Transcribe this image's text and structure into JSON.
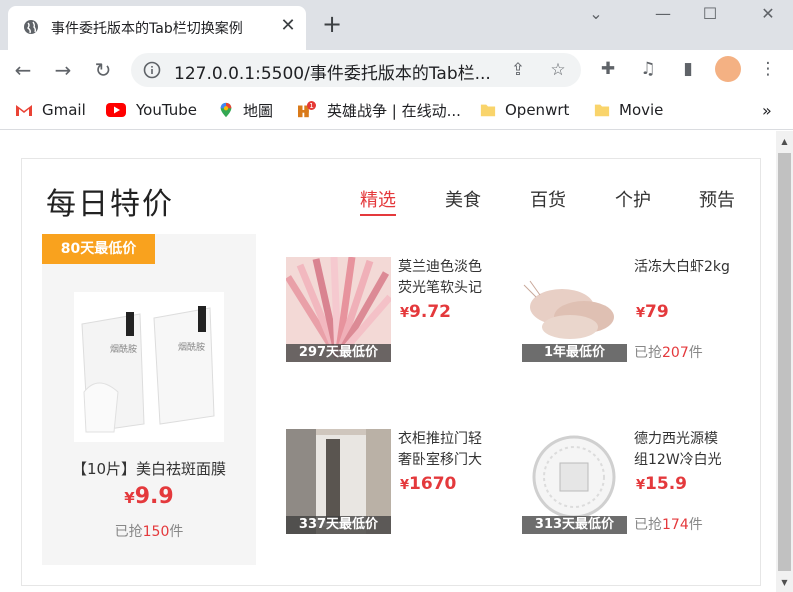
{
  "browser": {
    "tab_title": "事件委托版本的Tab栏切换案例",
    "tab_close": "✕",
    "new_tab": "+",
    "url": "127.0.0.1:5500/事件委托版本的Tab栏...",
    "window_controls": [
      "⌄",
      "—",
      "☐",
      "✕"
    ]
  },
  "bookmarks": [
    {
      "label": "Gmail",
      "icon": "gmail-icon"
    },
    {
      "label": "YouTube",
      "icon": "youtube-icon"
    },
    {
      "label": "地圖",
      "icon": "maps-icon"
    },
    {
      "label": "英雄战争 | 在线动...",
      "icon": "game-icon"
    },
    {
      "label": "Openwrt",
      "icon": "folder-icon"
    },
    {
      "label": "Movie",
      "icon": "folder-icon"
    }
  ],
  "bookmarks_more": "»",
  "page": {
    "title": "每日特价",
    "tabs": [
      "精选",
      "美食",
      "百货",
      "个护",
      "预告"
    ],
    "active_tab": 0,
    "accent_color": "#e4393c",
    "feature": {
      "badge": "80天最低价",
      "name": "【10片】美白祛斑面膜",
      "yen": "¥",
      "price": "9.9",
      "sold_prefix": "已抢",
      "sold_count": "150",
      "sold_suffix": "件"
    },
    "items": [
      {
        "tag": "297天最低价",
        "name": "莫兰迪色淡色荧光笔软头记",
        "yen": "¥",
        "price": "9.72",
        "sold_prefix": "",
        "sold_count": "",
        "sold_suffix": ""
      },
      {
        "tag": "1年最低价",
        "name": "活冻大白虾2kg",
        "yen": "¥",
        "price": "79",
        "sold_prefix": "已抢",
        "sold_count": "207",
        "sold_suffix": "件"
      },
      {
        "tag": "337天最低价",
        "name": "衣柜推拉门轻奢卧室移门大",
        "yen": "¥",
        "price": "1670",
        "sold_prefix": "",
        "sold_count": "",
        "sold_suffix": ""
      },
      {
        "tag": "313天最低价",
        "name": "德力西光源模组12W冷白光",
        "yen": "¥",
        "price": "15.9",
        "sold_prefix": "已抢",
        "sold_count": "174",
        "sold_suffix": "件"
      }
    ]
  }
}
